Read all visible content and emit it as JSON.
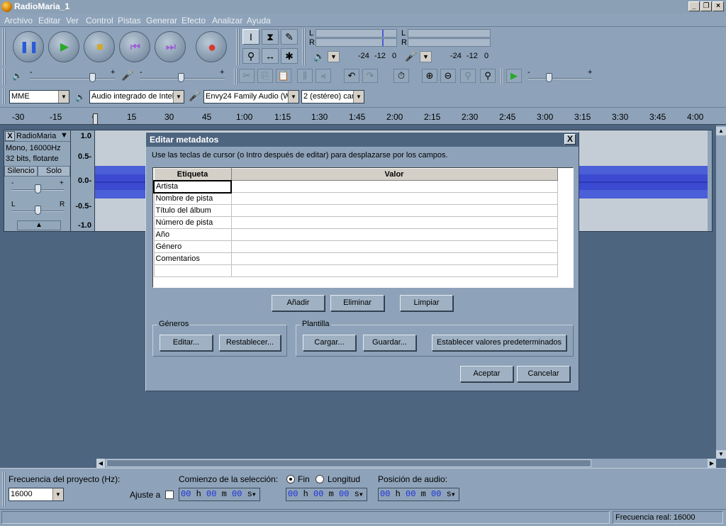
{
  "window": {
    "title": "RadioMaria_1"
  },
  "menu": [
    "Archivo",
    "Editar",
    "Ver",
    "Control",
    "Pistas",
    "Generar",
    "Efecto",
    "Analizar",
    "Ayuda"
  ],
  "meters": {
    "play_lr": [
      "L",
      "R"
    ],
    "rec_lr": [
      "L",
      "R"
    ],
    "play_scale": [
      "-24",
      "-12",
      "0"
    ],
    "rec_scale": [
      "-24",
      "-12",
      "0"
    ]
  },
  "sliders": {
    "minus": "-",
    "plus": "+"
  },
  "devices": {
    "host": "MME",
    "output": "Audio integrado de Intel",
    "input": "Envy24 Family Audio (WI",
    "channels": "2 (estéreo) car"
  },
  "ruler": [
    "-30",
    "-15",
    "0",
    "15",
    "30",
    "45",
    "1:00",
    "1:15",
    "1:30",
    "1:45",
    "2:00",
    "2:15",
    "2:30",
    "2:45",
    "3:00",
    "3:15",
    "3:30",
    "3:45",
    "4:00"
  ],
  "track": {
    "close": "X",
    "name": "RadioMaria",
    "info1": "Mono, 16000Hz",
    "info2": "32 bits, flotante",
    "mute": "Silencio",
    "solo": "Solo",
    "gain_minus": "-",
    "gain_plus": "+",
    "pan_left": "L",
    "pan_right": "R",
    "scale": [
      "1.0",
      "0.5-",
      "0.0-",
      "-0.5-",
      "-1.0"
    ]
  },
  "dialog": {
    "title": "Editar metadatos",
    "close": "X",
    "instructions": "Use las teclas de cursor (o Intro después de editar) para desplazarse por los campos.",
    "col_tag": "Etiqueta",
    "col_value": "Valor",
    "rows": [
      "Artista",
      "Nombre de pista",
      "Título del álbum",
      "Número de pista",
      "Año",
      "Género",
      "Comentarios",
      ""
    ],
    "add": "Añadir",
    "delete": "Eliminar",
    "clear": "Limpiar",
    "genres_label": "Géneros",
    "edit": "Editar...",
    "reset": "Restablecer...",
    "template_label": "Plantilla",
    "load": "Cargar...",
    "save": "Guardar...",
    "set_defaults": "Establecer valores predeterminados",
    "ok": "Aceptar",
    "cancel": "Cancelar"
  },
  "bottom": {
    "rate_label": "Frecuencia del proyecto (Hz):",
    "rate_value": "16000",
    "snap_label": "Ajuste a",
    "sel_label": "Comienzo de la selección:",
    "end_label": "Fin",
    "length_label": "Longitud",
    "pos_label": "Posición de audio:",
    "time_value": [
      "00",
      "00",
      "00"
    ],
    "time_units": [
      "h",
      "m",
      "s"
    ]
  },
  "status": {
    "actual_rate": "Frecuencia real: 16000"
  }
}
